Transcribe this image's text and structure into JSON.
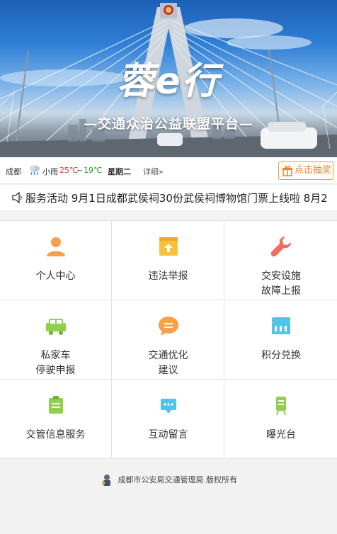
{
  "banner": {
    "logo_main": "蓉",
    "logo_e": "e",
    "logo_tail": "行",
    "tagline": "—交通众治公益联盟平台—"
  },
  "weather": {
    "city": "成都",
    "icon": "light-rain-icon",
    "condition": "小雨",
    "high": "25℃",
    "separator": "~",
    "low": "19℃",
    "weekday": "星期二",
    "detail": "详细»",
    "hi_color": "#e53935",
    "lo_color": "#2e9b2e"
  },
  "lottery": {
    "label": "点击抽奖",
    "icon": "gift-icon",
    "color": "#f0822a"
  },
  "notice": {
    "icon": "speaker-icon",
    "text": "服务活动 9月1日成都武侯祠30份武侯祠博物馆门票上线啦 8月2"
  },
  "grid": [
    {
      "label": "个人中心",
      "icon": "person-icon",
      "color": "#f5a04a"
    },
    {
      "label": "违法举报",
      "icon": "report-upload-icon",
      "color": "#f7c23a"
    },
    {
      "label": "交安设施\n故障上报",
      "icon": "wrench-icon",
      "color": "#f26b5b"
    },
    {
      "label": "私家车\n停驶申报",
      "icon": "car-icon",
      "color": "#8fd14f"
    },
    {
      "label": "交通优化\n建议",
      "icon": "chat-bubble-icon",
      "color": "#f5a04a"
    },
    {
      "label": "积分兑换",
      "icon": "shop-icon",
      "color": "#4fc3e8"
    },
    {
      "label": "交管信息服务",
      "icon": "clipboard-icon",
      "color": "#8fd14f"
    },
    {
      "label": "互动留言",
      "icon": "message-icon",
      "color": "#4fc3e8"
    },
    {
      "label": "曝光台",
      "icon": "board-icon",
      "color": "#8fd14f"
    }
  ],
  "footer": {
    "text": "成都市公安局交通管理局 版权所有",
    "icon": "police-badge-icon"
  }
}
